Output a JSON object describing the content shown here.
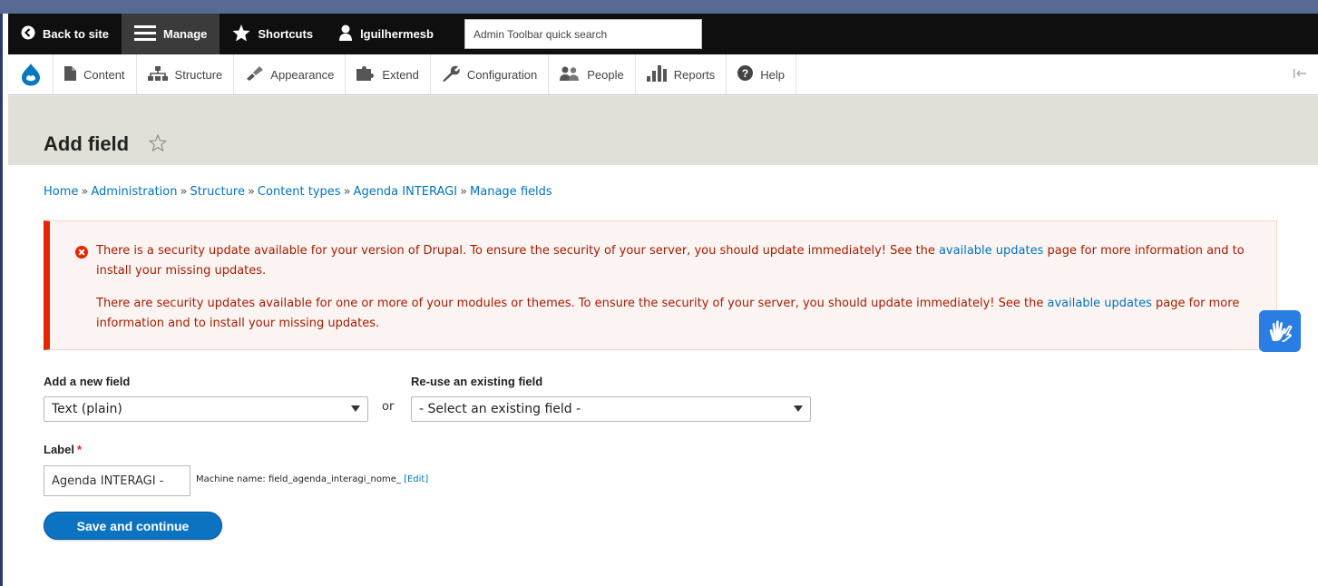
{
  "toolbar": {
    "back_to_site": "Back to site",
    "manage": "Manage",
    "shortcuts": "Shortcuts",
    "user": "lguilhermesb",
    "search_placeholder": "Admin Toolbar quick search"
  },
  "tray": {
    "items": [
      {
        "label": "Content",
        "icon": "file-icon"
      },
      {
        "label": "Structure",
        "icon": "structure-icon"
      },
      {
        "label": "Appearance",
        "icon": "paintbrush-icon"
      },
      {
        "label": "Extend",
        "icon": "puzzle-icon"
      },
      {
        "label": "Configuration",
        "icon": "wrench-icon"
      },
      {
        "label": "People",
        "icon": "people-icon"
      },
      {
        "label": "Reports",
        "icon": "bar-chart-icon"
      },
      {
        "label": "Help",
        "icon": "help-icon"
      }
    ]
  },
  "page": {
    "title": "Add field"
  },
  "breadcrumb": {
    "sep": "»",
    "items": [
      "Home",
      "Administration",
      "Structure",
      "Content types",
      "Agenda INTERAGI",
      "Manage fields"
    ]
  },
  "messages": {
    "p1_before": "There is a security update available for your version of Drupal. To ensure the security of your server, you should update immediately! See the",
    "p1_link": "available updates",
    "p1_after": "page for more information and to install your missing updates.",
    "p2_before": "There are security updates available for one or more of your modules or themes. To ensure the security of your server, you should update immediately! See the",
    "p2_link": "available updates",
    "p2_after": "page for more information and to install your missing updates."
  },
  "form": {
    "new_field_label": "Add a new field",
    "new_field_value": "Text (plain)",
    "or": "or",
    "existing_field_label": "Re-use an existing field",
    "existing_field_value": "- Select an existing field -",
    "label_label": "Label",
    "required_mark": "*",
    "label_value": "Agenda INTERAGI - ",
    "machine_name_prefix": "Machine name: field_agenda_interagi_nome_",
    "machine_name_edit": "[Edit]",
    "save_label": "Save and continue"
  },
  "colors": {
    "toolbar_bg": "#0f0f0f",
    "link": "#0074bd",
    "error_text": "#a51b00",
    "error_border": "#e62600",
    "primary_button": "#0b73c2",
    "a11y_button": "#2a7ee3"
  }
}
